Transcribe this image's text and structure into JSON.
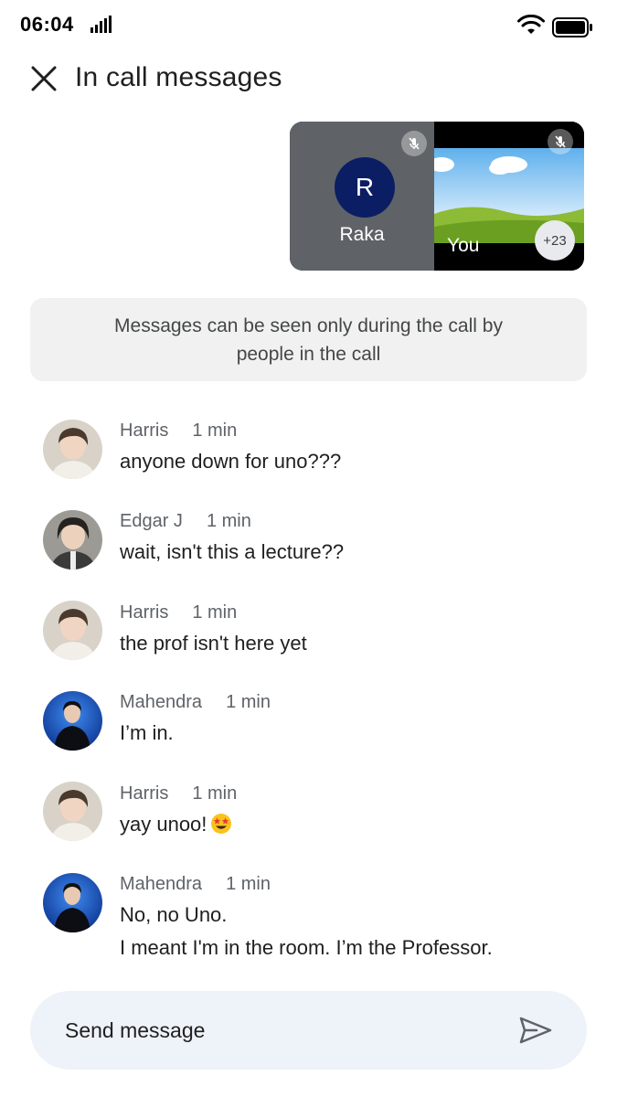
{
  "status_bar": {
    "time": "06:04"
  },
  "header": {
    "title": "In call messages",
    "close_icon": "close-icon"
  },
  "call_preview": {
    "participant": {
      "initial": "R",
      "name": "Raka",
      "avatar_color": "#0b1e63",
      "muted": true
    },
    "self": {
      "name": "You",
      "muted": true
    },
    "others_count": "+23"
  },
  "info_banner": {
    "text": "Messages can be seen only during the call by people in the call"
  },
  "messages": [
    {
      "sender": "Harris",
      "time": "1 min",
      "lines": [
        "anyone down for uno???"
      ]
    },
    {
      "sender": "Edgar J",
      "time": "1 min",
      "lines": [
        "wait, isn't this a lecture??"
      ]
    },
    {
      "sender": "Harris",
      "time": "1 min",
      "lines": [
        "the prof isn't here yet"
      ]
    },
    {
      "sender": "Mahendra",
      "time": "1 min",
      "lines": [
        "I’m in."
      ]
    },
    {
      "sender": "Harris",
      "time": "1 min",
      "lines": [
        "yay unoo!"
      ],
      "emoji": "star-struck-emoji"
    },
    {
      "sender": "Mahendra",
      "time": "1 min",
      "lines": [
        "No, no Uno.",
        "I meant I'm in the room. I’m the Professor."
      ]
    }
  ],
  "composer": {
    "placeholder": "Send message",
    "send_icon": "send-icon"
  },
  "colors": {
    "accent_dark_blue": "#0b1e63",
    "banner_bg": "#f1f1f1",
    "composer_bg": "#eef2f9",
    "tile_gray": "#5f6368"
  }
}
